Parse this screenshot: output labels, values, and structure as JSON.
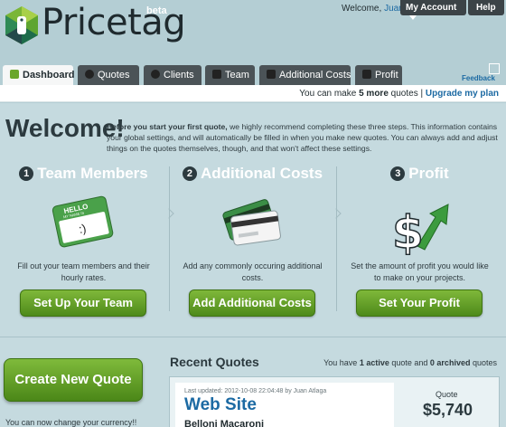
{
  "header": {
    "app_name": "Pricetag",
    "beta": "beta",
    "welcome_prefix": "Welcome,",
    "username": "Juan",
    "account_label": "My Account",
    "help_label": "Help"
  },
  "tabs": [
    {
      "label": "Dashboard",
      "active": true
    },
    {
      "label": "Quotes"
    },
    {
      "label": "Clients"
    },
    {
      "label": "Team"
    },
    {
      "label": "Additional Costs"
    },
    {
      "label": "Profit"
    }
  ],
  "feedback": "Feedback",
  "quota": {
    "prefix": "You can make",
    "count": "5 more",
    "suffix": "quotes |",
    "upgrade": "Upgrade my plan"
  },
  "welcome": {
    "title": "Welcome!",
    "intro_bold": "Before you start your first quote,",
    "intro_rest": " we highly recommend completing these three steps. This information contains your global settings, and will automatically be filled in when you make new quotes. You can always add and adjust things on the quotes themselves, though, and that won't affect these settings."
  },
  "steps": [
    {
      "num": "1",
      "title": "Team Members",
      "desc": "Fill out your team members and their hourly rates.",
      "button": "Set Up Your Team",
      "icon": "name-tag-icon",
      "tag_text": "HELLO",
      "tag_sub": "MY NAME IS",
      "tag_face": ":)"
    },
    {
      "num": "2",
      "title": "Additional Costs",
      "desc": "Add any commonly occuring additional costs.",
      "button": "Add Additional Costs",
      "icon": "credit-cards-icon"
    },
    {
      "num": "3",
      "title": "Profit",
      "desc": "Set the amount of profit you would like to make on your projects.",
      "button": "Set Your Profit",
      "icon": "dollar-arrow-icon",
      "glyph": "$"
    }
  ],
  "create_button": "Create New Quote",
  "currency_note": "You can now change your currency!!",
  "recent": {
    "title": "Recent Quotes",
    "count_prefix": "You have",
    "active": "1 active",
    "mid": "quote and",
    "archived": "0 archived",
    "suffix": "quotes"
  },
  "quote": {
    "updated": "Last updated: 2012-10-08 22:04:48 by Juan Atlaga",
    "name": "Web Site",
    "client": "Belloni Macaroni",
    "price_label": "Quote",
    "price": "$5,740"
  },
  "colors": {
    "background": "#b4ced4",
    "content": "#c5dadf",
    "link": "#1c6aa3",
    "green": "#6aa62c",
    "dark_tab": "#4b5357"
  }
}
